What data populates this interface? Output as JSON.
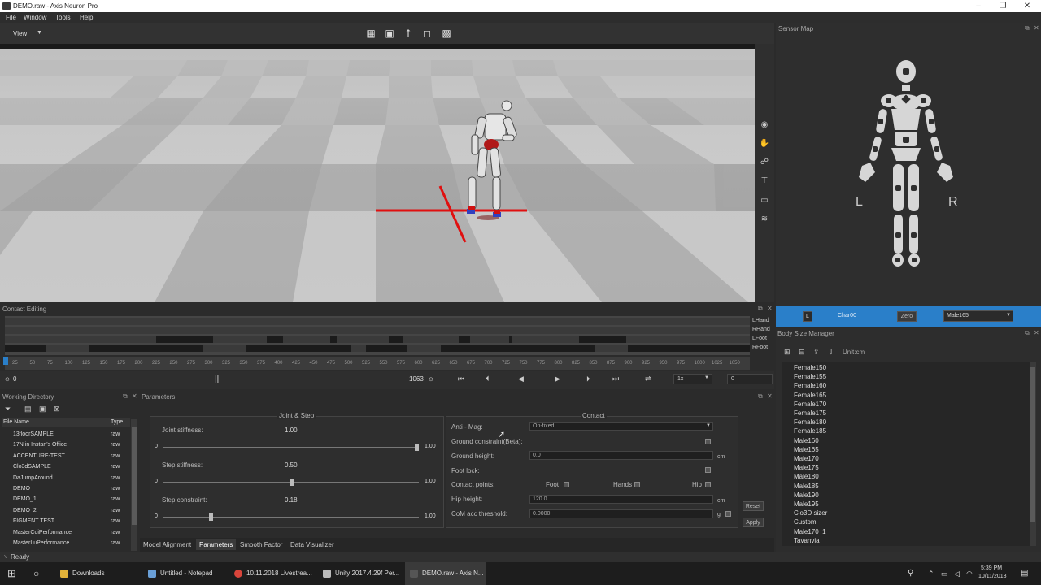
{
  "window": {
    "title": "DEMO.raw - Axis Neuron Pro",
    "min": "–",
    "max": "❐",
    "close": "✕"
  },
  "menu": [
    "File",
    "Window",
    "Tools",
    "Help"
  ],
  "viewbar": {
    "view_label": "View"
  },
  "sensor_map": {
    "title": "Sensor Map",
    "left_label": "L",
    "right_label": "R"
  },
  "sensor_bar": {
    "side": "L",
    "char": "Char00",
    "zero": "Zero",
    "body": "Male165"
  },
  "body_size_manager": {
    "title": "Body Size Manager",
    "unit": "Unit:cm",
    "items": [
      "Female150",
      "Female155",
      "Female160",
      "Female165",
      "Female170",
      "Female175",
      "Female180",
      "Female185",
      "Male160",
      "Male165",
      "Male170",
      "Male175",
      "Male180",
      "Male185",
      "Male190",
      "Male195",
      "Clo3D sizer",
      "Custom",
      "Male170_1",
      "Tavanvia"
    ]
  },
  "contact_editing": {
    "title": "Contact Editing",
    "tracks": [
      "LHand",
      "RHand",
      "LFoot",
      "RFoot"
    ],
    "ticks": [
      "25",
      "50",
      "75",
      "100",
      "125",
      "150",
      "175",
      "200",
      "225",
      "250",
      "275",
      "300",
      "325",
      "350",
      "375",
      "400",
      "425",
      "450",
      "475",
      "500",
      "525",
      "550",
      "575",
      "600",
      "625",
      "650",
      "675",
      "700",
      "725",
      "750",
      "775",
      "800",
      "825",
      "850",
      "875",
      "900",
      "925",
      "950",
      "975",
      "1000",
      "1025",
      "1050"
    ]
  },
  "playbar": {
    "start": "0",
    "end": "1063",
    "speed": "1x",
    "frame": "0"
  },
  "working_directory": {
    "title": "Working Directory",
    "col_name": "File Name",
    "col_type": "Type",
    "files": [
      {
        "name": "13floorSAMPLE",
        "type": "raw"
      },
      {
        "name": "17N in  Instan's Office",
        "type": "raw"
      },
      {
        "name": "ACCENTURE-TEST",
        "type": "raw"
      },
      {
        "name": "Clo3dSAMPLE",
        "type": "raw"
      },
      {
        "name": "DaJumpAround",
        "type": "raw"
      },
      {
        "name": "DEMO",
        "type": "raw"
      },
      {
        "name": "DEMO_1",
        "type": "raw"
      },
      {
        "name": "DEMO_2",
        "type": "raw"
      },
      {
        "name": "FIGMENT TEST",
        "type": "raw"
      },
      {
        "name": "MasterCoiPerformance",
        "type": "raw"
      },
      {
        "name": "MasterLuPerformance",
        "type": "raw"
      }
    ]
  },
  "parameters": {
    "title": "Parameters",
    "joint_step": {
      "title": "Joint & Step",
      "rows": [
        {
          "label": "Joint stiffness:",
          "value": "1.00",
          "min": "0",
          "max": "1.00",
          "level": 1.0
        },
        {
          "label": "Step stiffness:",
          "value": "0.50",
          "min": "0",
          "max": "1.00",
          "level": 0.5
        },
        {
          "label": "Step constraint:",
          "value": "0.18",
          "min": "0",
          "max": "1.00",
          "level": 0.18
        }
      ]
    },
    "contact": {
      "title": "Contact",
      "anti_mag_label": "Anti - Mag:",
      "anti_mag_value": "On-fixed",
      "ground_constraint": "Ground constraint(Beta):",
      "ground_height": "Ground height:",
      "ground_height_value": "0.0",
      "ground_unit": "cm",
      "foot_lock": "Foot lock:",
      "contact_points": "Contact points:",
      "foot": "Foot",
      "hands": "Hands",
      "hip": "Hip",
      "hip_height": "Hip height:",
      "hip_height_value": "120.0",
      "hip_unit": "cm",
      "com_threshold": "CoM acc threshold:",
      "com_value": "0.0000",
      "com_unit": "g"
    },
    "reset": "Reset",
    "apply": "Apply"
  },
  "tabs": [
    "Model Alignment",
    "Parameters",
    "Smooth Factor",
    "Data Visualizer"
  ],
  "status": "Ready",
  "taskbar": {
    "items": [
      "Downloads",
      "Untitled - Notepad",
      "10.11.2018 Livestrea...",
      "Unity 2017.4.29f Per...",
      "DEMO.raw - Axis N..."
    ],
    "time": "5:39 PM",
    "date": "10/11/2018"
  },
  "colors": {
    "accent": "#2a7fc9",
    "red": "#e01010",
    "viewport_light": "#d4d4d4",
    "viewport_dark": "#9c9c9c"
  }
}
